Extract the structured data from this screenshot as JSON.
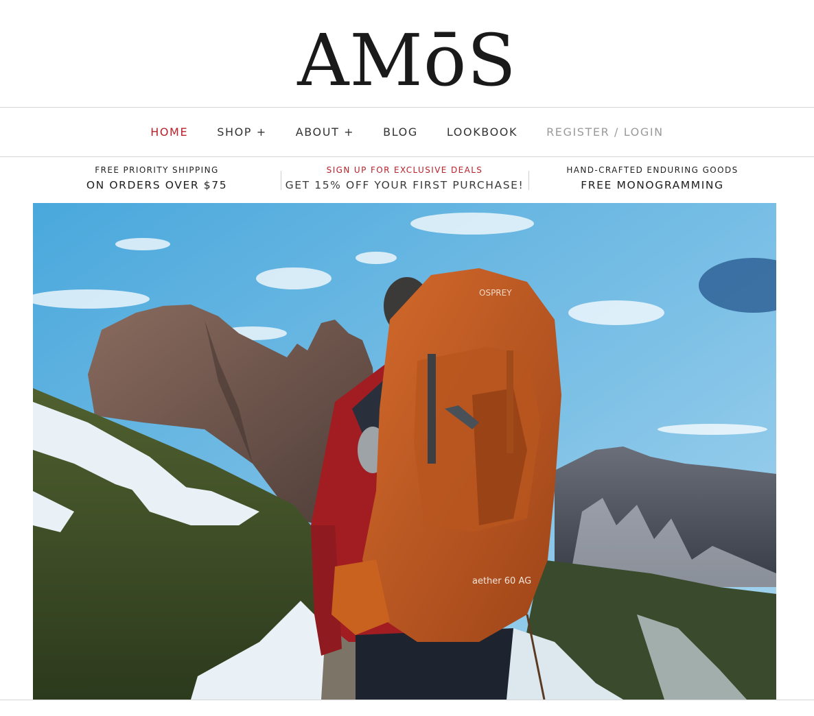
{
  "brand": {
    "logo_text": "AMōS"
  },
  "nav": {
    "items": [
      {
        "label": "HOME",
        "state": "active"
      },
      {
        "label": "SHOP +",
        "state": "normal"
      },
      {
        "label": "ABOUT +",
        "state": "normal"
      },
      {
        "label": "BLOG",
        "state": "normal"
      },
      {
        "label": "LOOKBOOK",
        "state": "normal"
      },
      {
        "label": "REGISTER / LOGIN",
        "state": "muted"
      }
    ]
  },
  "promo": [
    {
      "top": "FREE PRIORITY SHIPPING",
      "bottom": "ON ORDERS OVER $75"
    },
    {
      "top": "SIGN UP FOR EXCLUSIVE DEALS",
      "bottom": "GET 15% OFF YOUR FIRST PURCHASE!"
    },
    {
      "top": "HAND-CRAFTED ENDURING GOODS",
      "bottom": "FREE MONOGRAMMING"
    }
  ],
  "hero": {
    "backpack_brand_top": "OSPREY",
    "backpack_model": "aether 60 AG"
  },
  "colors": {
    "accent_red": "#b8202a",
    "text_dark": "#222222",
    "muted_grey": "#9a9a9a",
    "rule": "#d4d4d4"
  }
}
